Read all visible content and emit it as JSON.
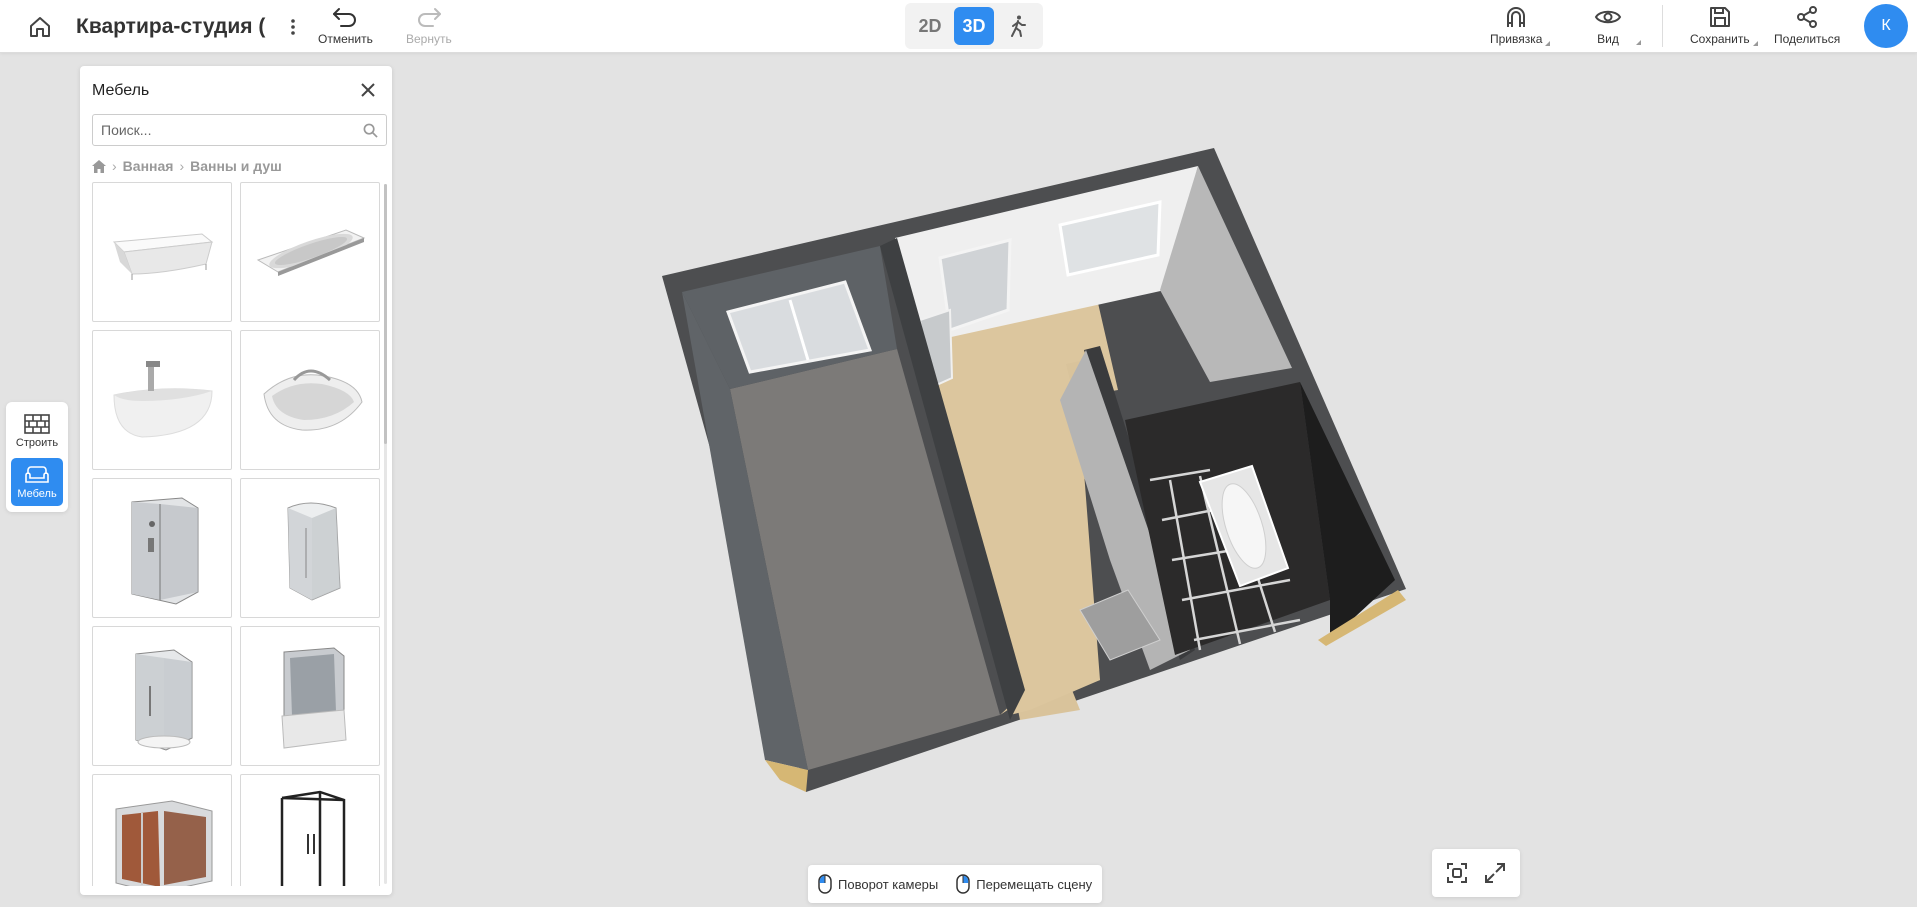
{
  "header": {
    "project_title": "Квартира-студия (пл",
    "undo_label": "Отменить",
    "redo_label": "Вернуть",
    "mode_2d": "2D",
    "mode_3d": "3D",
    "snap_label": "Привязка",
    "view_label": "Вид",
    "save_label": "Сохранить",
    "share_label": "Поделиться",
    "avatar_initial": "К",
    "active_mode": "3D"
  },
  "rail": {
    "build_label": "Строить",
    "furniture_label": "Мебель"
  },
  "panel": {
    "title": "Мебель",
    "search_placeholder": "Поиск...",
    "breadcrumb": [
      "Ванная",
      "Ванны и душ"
    ],
    "items": [
      "bathtub-rectangular",
      "bathtub-oval-builtin",
      "bathtub-asymmetric-freestanding",
      "bathtub-corner",
      "shower-cabin-round",
      "shower-cabin-asymmetric",
      "shower-cabin-quarter",
      "shower-cabin-with-tray",
      "steam-shower-box",
      "shower-enclosure-glass"
    ]
  },
  "hints": {
    "rotate_label": "Поворот камеры",
    "move_label": "Перемещать сцену"
  },
  "colors": {
    "accent": "#2f8cf0",
    "background": "#e3e3e3"
  }
}
